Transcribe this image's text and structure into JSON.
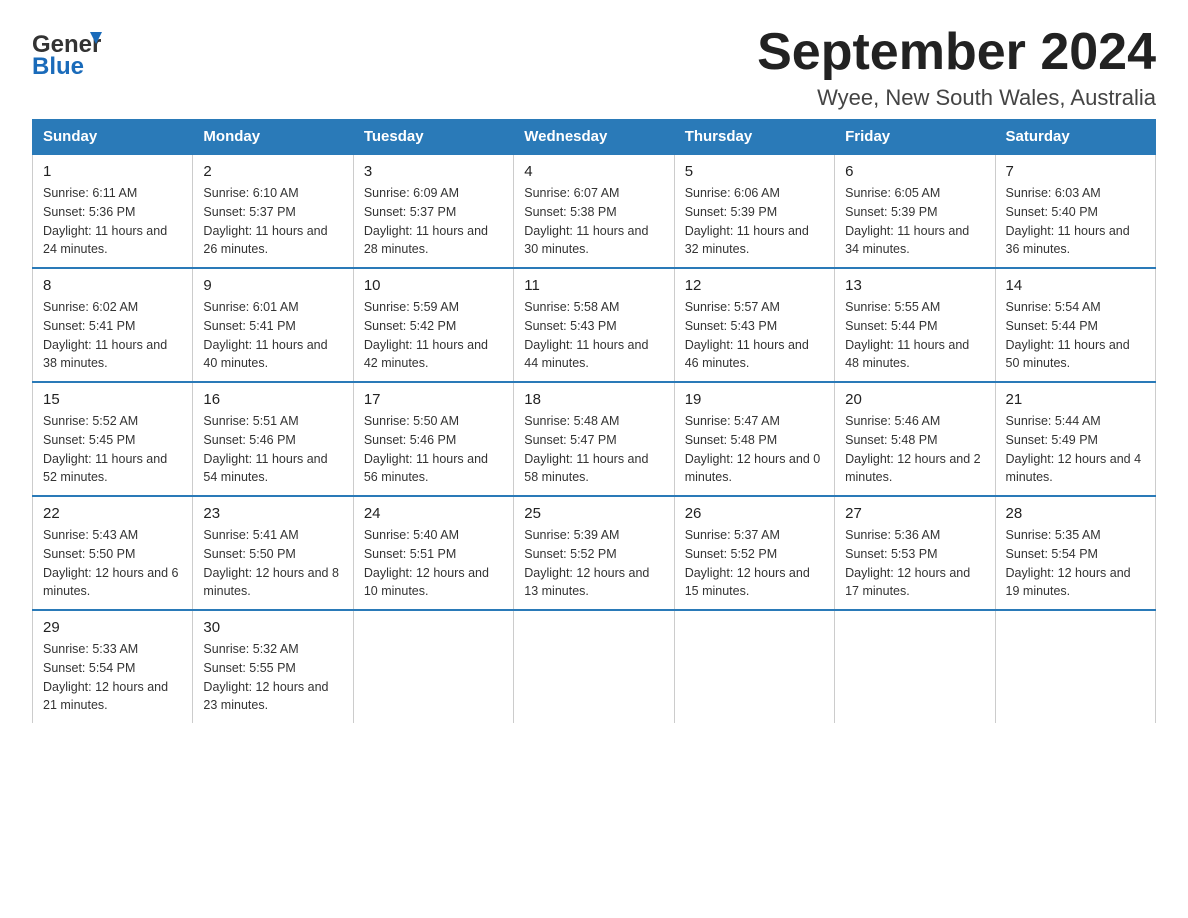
{
  "header": {
    "logo_general": "General",
    "logo_blue": "Blue",
    "title": "September 2024",
    "location": "Wyee, New South Wales, Australia"
  },
  "columns": [
    "Sunday",
    "Monday",
    "Tuesday",
    "Wednesday",
    "Thursday",
    "Friday",
    "Saturday"
  ],
  "weeks": [
    [
      {
        "day": "1",
        "sunrise": "6:11 AM",
        "sunset": "5:36 PM",
        "daylight": "11 hours and 24 minutes."
      },
      {
        "day": "2",
        "sunrise": "6:10 AM",
        "sunset": "5:37 PM",
        "daylight": "11 hours and 26 minutes."
      },
      {
        "day": "3",
        "sunrise": "6:09 AM",
        "sunset": "5:37 PM",
        "daylight": "11 hours and 28 minutes."
      },
      {
        "day": "4",
        "sunrise": "6:07 AM",
        "sunset": "5:38 PM",
        "daylight": "11 hours and 30 minutes."
      },
      {
        "day": "5",
        "sunrise": "6:06 AM",
        "sunset": "5:39 PM",
        "daylight": "11 hours and 32 minutes."
      },
      {
        "day": "6",
        "sunrise": "6:05 AM",
        "sunset": "5:39 PM",
        "daylight": "11 hours and 34 minutes."
      },
      {
        "day": "7",
        "sunrise": "6:03 AM",
        "sunset": "5:40 PM",
        "daylight": "11 hours and 36 minutes."
      }
    ],
    [
      {
        "day": "8",
        "sunrise": "6:02 AM",
        "sunset": "5:41 PM",
        "daylight": "11 hours and 38 minutes."
      },
      {
        "day": "9",
        "sunrise": "6:01 AM",
        "sunset": "5:41 PM",
        "daylight": "11 hours and 40 minutes."
      },
      {
        "day": "10",
        "sunrise": "5:59 AM",
        "sunset": "5:42 PM",
        "daylight": "11 hours and 42 minutes."
      },
      {
        "day": "11",
        "sunrise": "5:58 AM",
        "sunset": "5:43 PM",
        "daylight": "11 hours and 44 minutes."
      },
      {
        "day": "12",
        "sunrise": "5:57 AM",
        "sunset": "5:43 PM",
        "daylight": "11 hours and 46 minutes."
      },
      {
        "day": "13",
        "sunrise": "5:55 AM",
        "sunset": "5:44 PM",
        "daylight": "11 hours and 48 minutes."
      },
      {
        "day": "14",
        "sunrise": "5:54 AM",
        "sunset": "5:44 PM",
        "daylight": "11 hours and 50 minutes."
      }
    ],
    [
      {
        "day": "15",
        "sunrise": "5:52 AM",
        "sunset": "5:45 PM",
        "daylight": "11 hours and 52 minutes."
      },
      {
        "day": "16",
        "sunrise": "5:51 AM",
        "sunset": "5:46 PM",
        "daylight": "11 hours and 54 minutes."
      },
      {
        "day": "17",
        "sunrise": "5:50 AM",
        "sunset": "5:46 PM",
        "daylight": "11 hours and 56 minutes."
      },
      {
        "day": "18",
        "sunrise": "5:48 AM",
        "sunset": "5:47 PM",
        "daylight": "11 hours and 58 minutes."
      },
      {
        "day": "19",
        "sunrise": "5:47 AM",
        "sunset": "5:48 PM",
        "daylight": "12 hours and 0 minutes."
      },
      {
        "day": "20",
        "sunrise": "5:46 AM",
        "sunset": "5:48 PM",
        "daylight": "12 hours and 2 minutes."
      },
      {
        "day": "21",
        "sunrise": "5:44 AM",
        "sunset": "5:49 PM",
        "daylight": "12 hours and 4 minutes."
      }
    ],
    [
      {
        "day": "22",
        "sunrise": "5:43 AM",
        "sunset": "5:50 PM",
        "daylight": "12 hours and 6 minutes."
      },
      {
        "day": "23",
        "sunrise": "5:41 AM",
        "sunset": "5:50 PM",
        "daylight": "12 hours and 8 minutes."
      },
      {
        "day": "24",
        "sunrise": "5:40 AM",
        "sunset": "5:51 PM",
        "daylight": "12 hours and 10 minutes."
      },
      {
        "day": "25",
        "sunrise": "5:39 AM",
        "sunset": "5:52 PM",
        "daylight": "12 hours and 13 minutes."
      },
      {
        "day": "26",
        "sunrise": "5:37 AM",
        "sunset": "5:52 PM",
        "daylight": "12 hours and 15 minutes."
      },
      {
        "day": "27",
        "sunrise": "5:36 AM",
        "sunset": "5:53 PM",
        "daylight": "12 hours and 17 minutes."
      },
      {
        "day": "28",
        "sunrise": "5:35 AM",
        "sunset": "5:54 PM",
        "daylight": "12 hours and 19 minutes."
      }
    ],
    [
      {
        "day": "29",
        "sunrise": "5:33 AM",
        "sunset": "5:54 PM",
        "daylight": "12 hours and 21 minutes."
      },
      {
        "day": "30",
        "sunrise": "5:32 AM",
        "sunset": "5:55 PM",
        "daylight": "12 hours and 23 minutes."
      },
      null,
      null,
      null,
      null,
      null
    ]
  ]
}
